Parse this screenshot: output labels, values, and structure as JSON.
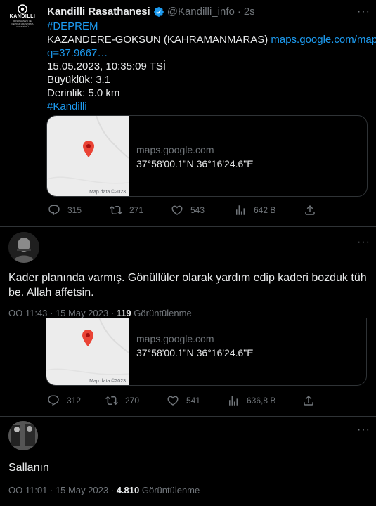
{
  "tweet1": {
    "author_name": "Kandilli Rasathanesi",
    "handle": "@Kandilli_info",
    "dot": "·",
    "time": "2s",
    "avatar_text": "KANDILLI",
    "avatar_subtext": "RASATHANESI VE DEPREM ARAŞTIRMA ENSTİTÜSÜ",
    "hashtag1": "#DEPREM",
    "location_text": "KAZANDERE-GOKSUN (KAHRAMANMARAS)",
    "maps_link_line1": "maps.google.com/maps?",
    "maps_link_line2": "q=37.9667…",
    "datetime_line": "15.05.2023, 10:35:09 TSİ",
    "magnitude_line": "Büyüklük: 3.1",
    "depth_line": "Derinlik: 5.0 km",
    "hashtag2": "#Kandilli",
    "card": {
      "domain": "maps.google.com",
      "title": "37°58'00.1\"N 36°16'24.6\"E",
      "map_label": "Map data ©2023"
    },
    "actions": {
      "replies": "315",
      "retweets": "271",
      "likes": "543",
      "views": "642 B"
    }
  },
  "tweet2": {
    "text": "Kader planında varmış. Gönüllüler olarak yardım edip kaderi bozduk tüh be. Allah affetsin.",
    "meta_time": "ÖÖ 11:43 · 15 May 2023 ·",
    "views_count": "119",
    "views_label": "Görüntülenme",
    "card": {
      "domain": "maps.google.com",
      "title": "37°58'00.1\"N 36°16'24.6\"E",
      "map_label": "Map data ©2023"
    },
    "actions": {
      "replies": "312",
      "retweets": "270",
      "likes": "541",
      "views": "636,8 B"
    }
  },
  "tweet3": {
    "text": "Sallanın",
    "meta_time": "ÖÖ 11:01 · 15 May 2023 ·",
    "views_count": "4.810",
    "views_label": "Görüntülenme"
  },
  "colors": {
    "background": "#000000",
    "text": "#e7e9ea",
    "muted": "#71767b",
    "link": "#1d9bf0",
    "divider": "#2f3336",
    "map_pin": "#ea4335"
  }
}
